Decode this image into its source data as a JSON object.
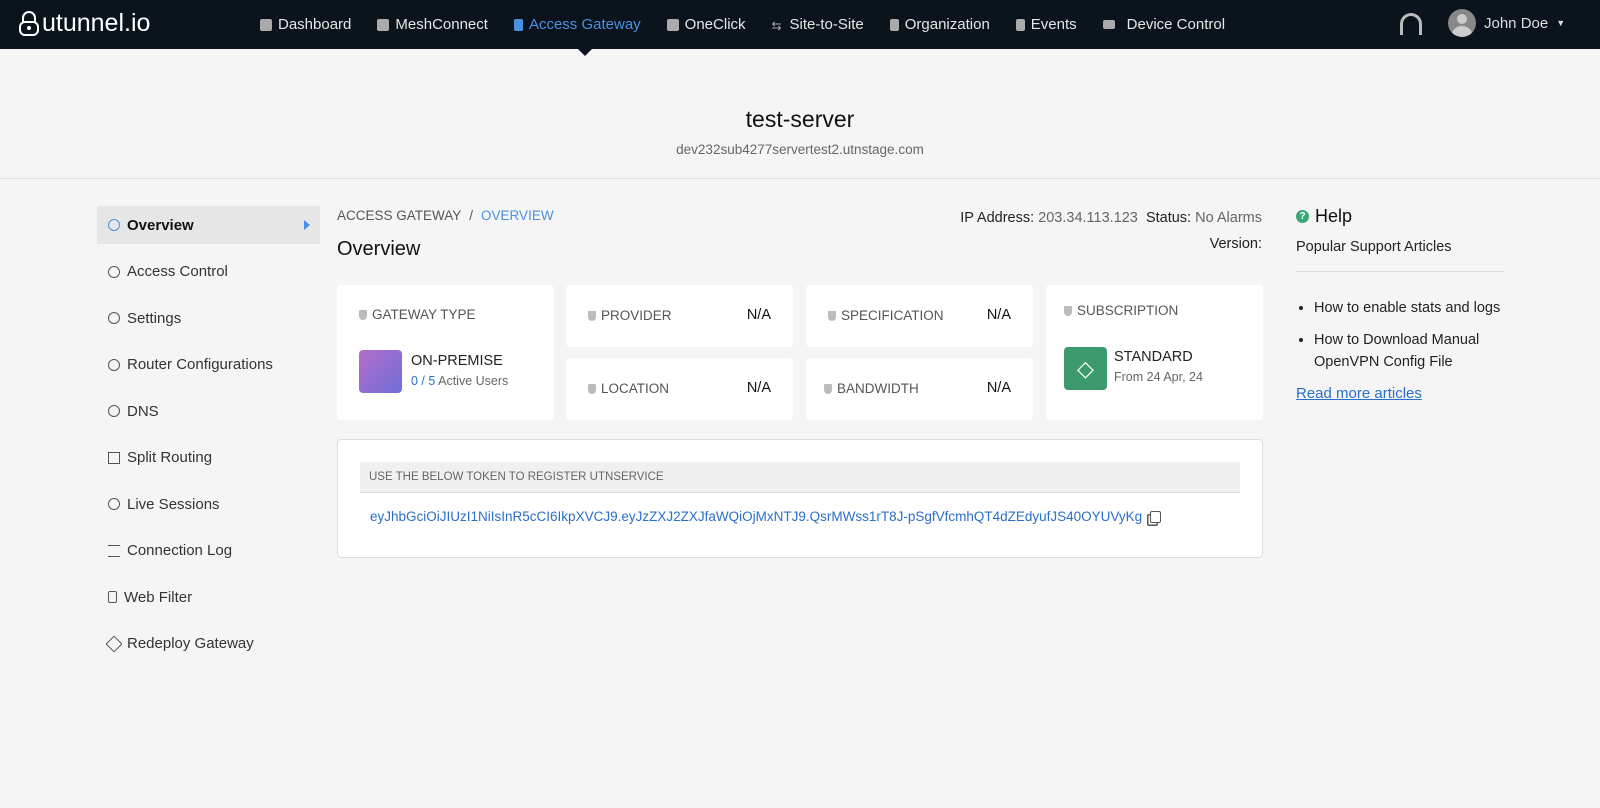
{
  "brand": "utunnel.io",
  "nav": [
    {
      "label": "Dashboard",
      "icon": "home-icon"
    },
    {
      "label": "MeshConnect",
      "icon": "mesh-icon"
    },
    {
      "label": "Access Gateway",
      "icon": "server-icon",
      "active": true
    },
    {
      "label": "OneClick",
      "icon": "grid-icon"
    },
    {
      "label": "Site-to-Site",
      "icon": "arrows-icon"
    },
    {
      "label": "Organization",
      "icon": "building-icon"
    },
    {
      "label": "Events",
      "icon": "list-icon"
    },
    {
      "label": "Device Control",
      "icon": "monitor-icon"
    }
  ],
  "user": {
    "name": "John Doe"
  },
  "server": {
    "name": "test-server",
    "host": "dev232sub4277servertest2.utnstage.com"
  },
  "sidebar": [
    {
      "label": "Overview",
      "active": true
    },
    {
      "label": "Access Control"
    },
    {
      "label": "Settings"
    },
    {
      "label": "Router Configurations"
    },
    {
      "label": "DNS"
    },
    {
      "label": "Split Routing"
    },
    {
      "label": "Live Sessions"
    },
    {
      "label": "Connection Log"
    },
    {
      "label": "Web Filter"
    },
    {
      "label": "Redeploy Gateway"
    }
  ],
  "breadcrumb": {
    "root": "ACCESS GATEWAY",
    "sep": "/",
    "current": "OVERVIEW"
  },
  "title": "Overview",
  "info": {
    "ip_label": "IP Address:",
    "ip": "203.34.113.123",
    "status_label": "Status:",
    "status": "No Alarms",
    "version_label": "Version:"
  },
  "cards": {
    "gateway_type": {
      "label": "GATEWAY TYPE",
      "value": "ON-PREMISE",
      "users_active": "0",
      "users_total": "5",
      "users_sep": " / ",
      "users_suffix": "Active Users"
    },
    "provider": {
      "label": "PROVIDER",
      "value": "N/A"
    },
    "specification": {
      "label": "SPECIFICATION",
      "value": "N/A"
    },
    "location": {
      "label": "LOCATION",
      "value": "N/A"
    },
    "bandwidth": {
      "label": "BANDWIDTH",
      "value": "N/A"
    },
    "subscription": {
      "label": "SUBSCRIPTION",
      "plan": "STANDARD",
      "from": "From 24 Apr, 24"
    }
  },
  "token": {
    "heading": "USE THE BELOW TOKEN TO REGISTER UTNSERVICE",
    "value": "eyJhbGciOiJIUzI1NiIsInR5cCI6IkpXVCJ9.eyJzZXJ2ZXJfaWQiOjMxNTJ9.QsrMWss1rT8J-pSgfVfcmhQT4dZEdyufJS40OYUVyKg"
  },
  "help": {
    "title": "Help",
    "subtitle": "Popular Support Articles",
    "articles": [
      "How to enable stats and logs",
      "How to Download Manual OpenVPN Config File"
    ],
    "more": "Read more articles"
  }
}
